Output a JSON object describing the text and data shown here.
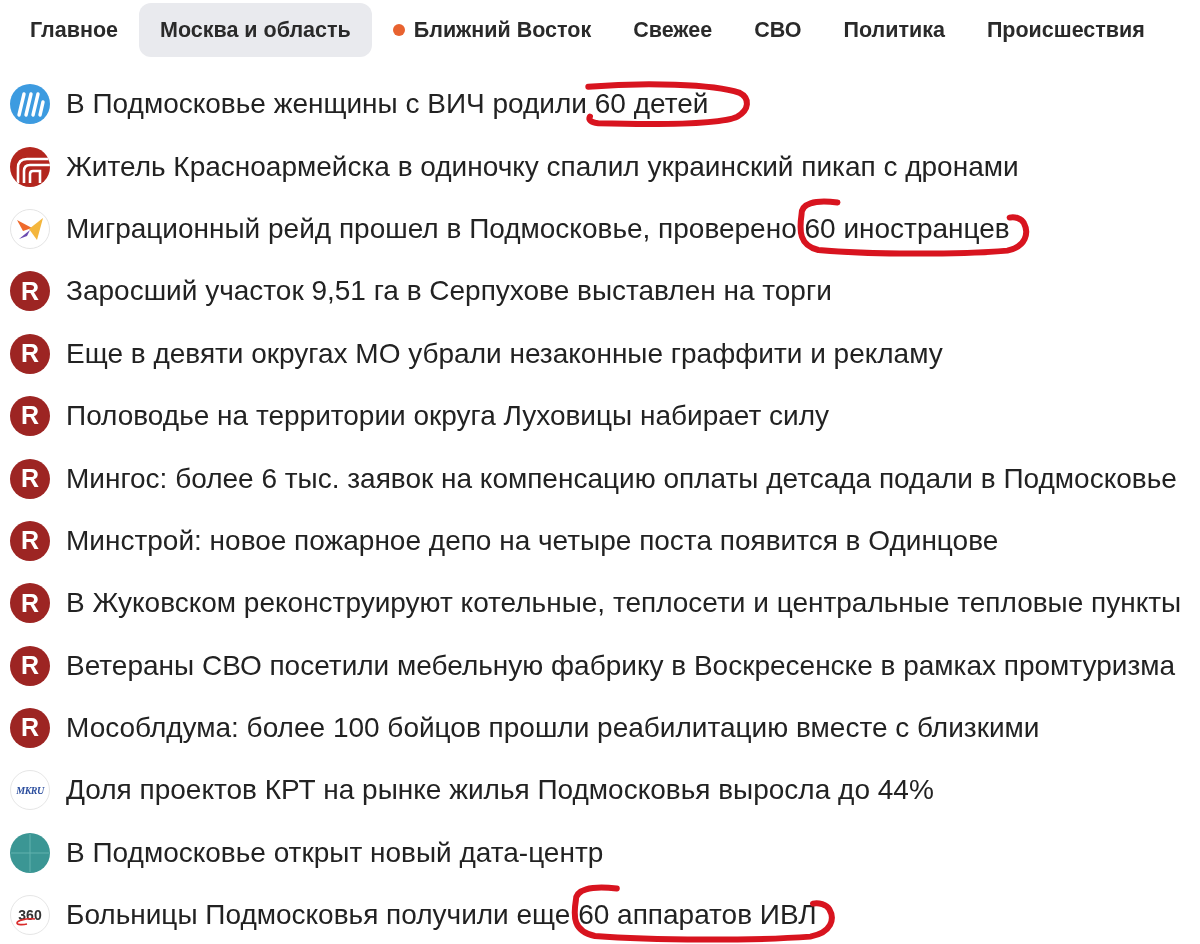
{
  "tabs": [
    {
      "label": "Главное",
      "selected": false
    },
    {
      "label": "Москва и область",
      "selected": true
    },
    {
      "label": "Ближний Восток",
      "selected": false,
      "color": "#e8622f"
    },
    {
      "label": "Свежее",
      "selected": false
    },
    {
      "label": "СВО",
      "selected": false
    },
    {
      "label": "Политика",
      "selected": false
    },
    {
      "label": "Происшествия",
      "selected": false
    }
  ],
  "headlines": [
    {
      "source": {
        "kind": "stripes"
      },
      "title": "В Подмосковье женщины с ВИЧ родили ",
      "circled": {
        "kind": "loop",
        "text": "60 детей"
      }
    },
    {
      "source": {
        "kind": "arches"
      },
      "title": "Житель Красноармейска в одиночку спалил украинский пикап с дронами"
    },
    {
      "source": {
        "kind": "bird"
      },
      "title": "Миграционный рейд прошел в Подмосковье, проверено ",
      "circled": {
        "kind": "bracket",
        "text": "60 иностранцев"
      }
    },
    {
      "source": {
        "kind": "letter",
        "text": "R"
      },
      "title": "Заросший участок 9,51 га в Серпухове выставлен на торги"
    },
    {
      "source": {
        "kind": "letter",
        "text": "R"
      },
      "title": "Еще в девяти округах МО убрали незаконные граффити и рекламу"
    },
    {
      "source": {
        "kind": "letter",
        "text": "R"
      },
      "title": "Половодье на территории округа Луховицы набирает силу"
    },
    {
      "source": {
        "kind": "letter",
        "text": "R"
      },
      "title": "Мингос: более 6 тыс. заявок на компенсацию оплаты детсада подали в Подмосковье"
    },
    {
      "source": {
        "kind": "letter",
        "text": "R"
      },
      "title": "Минстрой: новое пожарное депо на четыре поста появится в Одинцове"
    },
    {
      "source": {
        "kind": "letter",
        "text": "R"
      },
      "title": "В Жуковском реконструируют котельные, теплосети и центральные тепловые пункты"
    },
    {
      "source": {
        "kind": "letter",
        "text": "R"
      },
      "title": "Ветераны СВО посетили мебельную фабрику в Воскресенске в рамках промтуризма"
    },
    {
      "source": {
        "kind": "letter",
        "text": "R"
      },
      "title": "Мособлдума: более 100 бойцов прошли реабилитацию вместе с близкими"
    },
    {
      "source": {
        "kind": "wordmark",
        "text": "MKRU"
      },
      "title": "Доля проектов КРТ на рынке жилья Подмосковья выросла до 44%"
    },
    {
      "source": {
        "kind": "grid"
      },
      "title": "В Подмосковье открыт новый дата-центр"
    },
    {
      "source": {
        "kind": "swoosh",
        "text": "360"
      },
      "title": "Больницы Подмосковья получили еще ",
      "circled": {
        "kind": "bracket",
        "text": "60 аппаратов ИВЛ"
      }
    }
  ]
}
